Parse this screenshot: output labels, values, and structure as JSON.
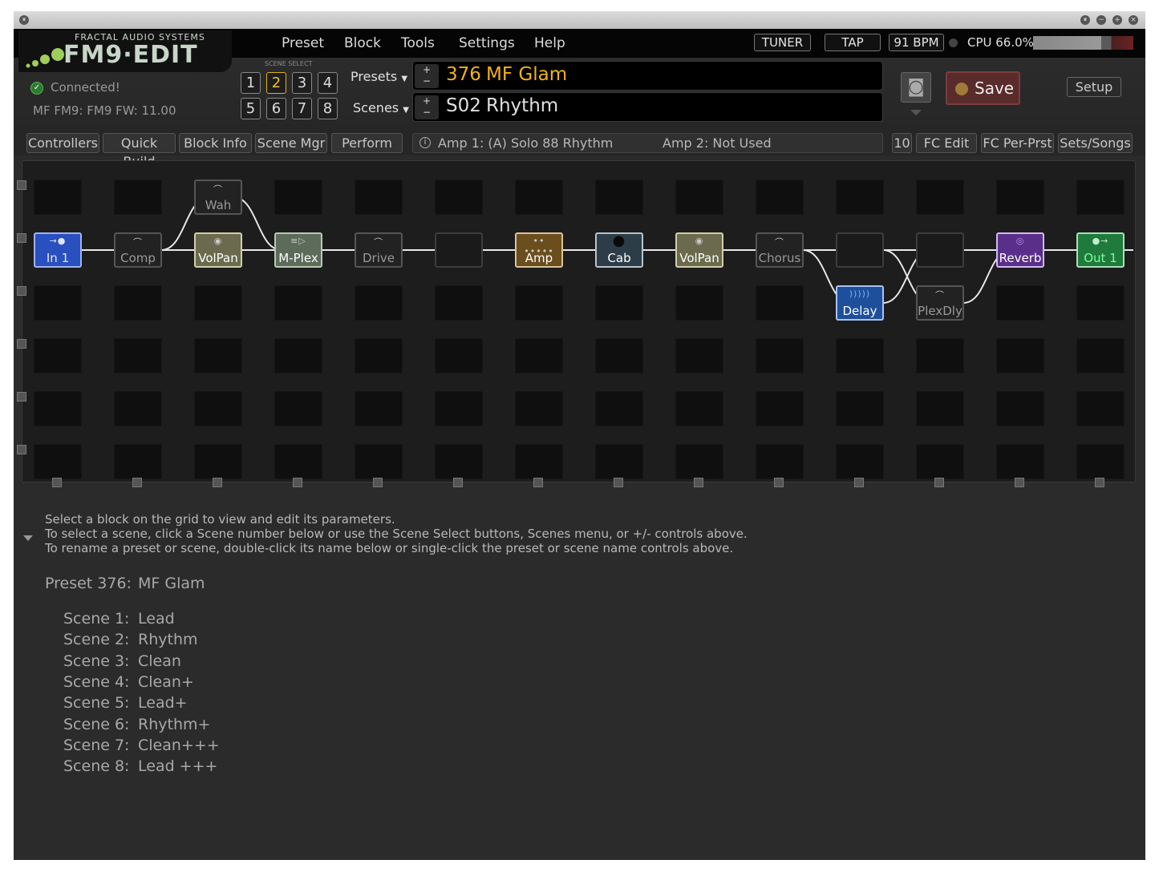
{
  "logo": {
    "brand": "FRACTAL AUDIO SYSTEMS",
    "product": "FM9·EDIT"
  },
  "menu": [
    "Preset",
    "Block",
    "Tools",
    "Settings",
    "Help"
  ],
  "toolbar": {
    "tuner": "TUNER",
    "tap": "TAP",
    "bpm": "91 BPM",
    "cpu": "CPU 66.0%",
    "cpu_percent": 66.0,
    "setup": "Setup",
    "save": "Save"
  },
  "status": {
    "connected": "Connected!",
    "firmware": "MF FM9: FM9 FW: 11.00"
  },
  "scene_select": {
    "label": "SCENE SELECT",
    "buttons": [
      "1",
      "2",
      "3",
      "4",
      "5",
      "6",
      "7",
      "8"
    ],
    "selected": "2"
  },
  "presets_label": "Presets",
  "scenes_label": "Scenes",
  "preset": {
    "number": "376",
    "name": "MF Glam",
    "color": "#f2b315"
  },
  "scene": {
    "number": "S02",
    "name": "Rhythm"
  },
  "tabs_left": [
    "Controllers",
    "Quick Build",
    "Block Info",
    "Scene Mgr",
    "Perform"
  ],
  "info": {
    "amp1": "Amp 1: (A) Solo 88 Rhythm",
    "amp2": "Amp 2: Not Used"
  },
  "tabs_right": [
    "10",
    "FC Edit",
    "FC Per-Prst",
    "Sets/Songs"
  ],
  "blocks": {
    "in1": {
      "label": "In 1",
      "color": "#2a4fbf"
    },
    "comp": {
      "label": "Comp"
    },
    "wah": {
      "label": "Wah"
    },
    "volpan1": {
      "label": "VolPan",
      "color": "#6b6a4e"
    },
    "mplex": {
      "label": "M-Plex",
      "color": "#5d6b5a"
    },
    "drive": {
      "label": "Drive"
    },
    "amp": {
      "label": "Amp",
      "color": "#6b4e1e"
    },
    "cab": {
      "label": "Cab",
      "color": "#2d3d48"
    },
    "volpan2": {
      "label": "VolPan",
      "color": "#6b6a4e"
    },
    "chorus": {
      "label": "Chorus"
    },
    "delay": {
      "label": "Delay",
      "color": "#1e4f9a"
    },
    "plexdly": {
      "label": "PlexDly"
    },
    "reverb": {
      "label": "Reverb",
      "color": "#5a2f8a"
    },
    "out1": {
      "label": "Out 1",
      "color": "#1f7a3c"
    }
  },
  "help": {
    "line1": "Select a block on the grid to view and edit its parameters.",
    "line2": "To select a scene, click a Scene number below or use the Scene Select buttons, Scenes menu, or +/- controls above.",
    "line3": "To rename a preset or scene, double-click its name below or single-click the preset or scene name controls above."
  },
  "summary": {
    "preset_label": "Preset 376:",
    "preset_name": "MF Glam",
    "scenes": [
      {
        "label": "Scene 1:",
        "name": "Lead"
      },
      {
        "label": "Scene 2:",
        "name": "Rhythm"
      },
      {
        "label": "Scene 3:",
        "name": "Clean"
      },
      {
        "label": "Scene 4:",
        "name": "Clean+"
      },
      {
        "label": "Scene 5:",
        "name": "Lead+"
      },
      {
        "label": "Scene 6:",
        "name": "Rhythm+"
      },
      {
        "label": "Scene 7:",
        "name": "Clean+++"
      },
      {
        "label": "Scene 8:",
        "name": "Lead +++"
      }
    ]
  }
}
